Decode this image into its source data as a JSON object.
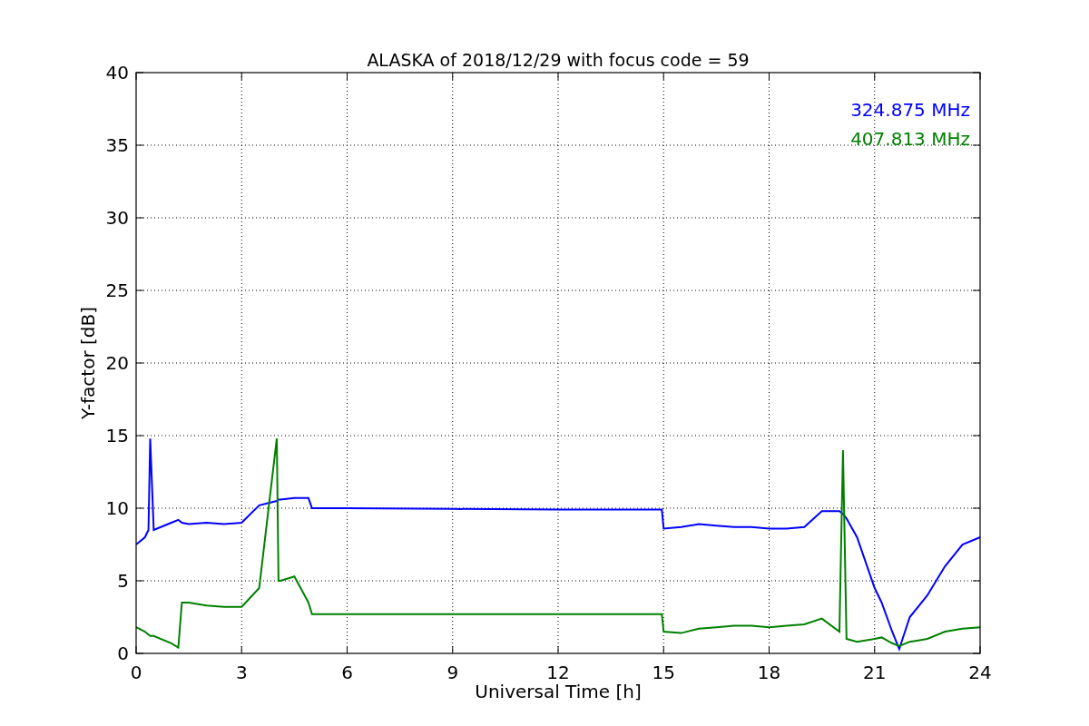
{
  "figure": {
    "chart_data": {
      "type": "line",
      "title": "ALASKA of 2018/12/29 with focus code = 59",
      "xlabel": "Universal Time [h]",
      "ylabel": "Y-factor [dB]",
      "x": [
        0,
        0.25,
        0.35,
        0.4,
        0.5,
        1,
        1.2,
        1.3,
        1.5,
        2,
        2.5,
        3,
        3.5,
        4,
        4.05,
        4.1,
        4.5,
        4.9,
        5,
        6,
        9,
        12,
        14.95,
        15,
        15.5,
        16,
        16.5,
        17,
        17.5,
        18,
        18.5,
        19,
        19.5,
        20,
        20.1,
        20.2,
        20.5,
        21,
        21.2,
        21.5,
        21.7,
        22,
        22.5,
        23,
        23.5,
        24
      ],
      "series": [
        {
          "name": "324.875 MHz",
          "color": "#0000ff",
          "values": [
            7.5,
            8.0,
            8.5,
            14.8,
            8.5,
            9.0,
            9.2,
            9.0,
            8.9,
            9.0,
            8.9,
            9.0,
            10.2,
            10.5,
            10.6,
            10.6,
            10.7,
            10.7,
            10.0,
            10.0,
            9.95,
            9.9,
            9.9,
            8.6,
            8.7,
            8.9,
            8.8,
            8.7,
            8.7,
            8.6,
            8.6,
            8.7,
            9.8,
            9.8,
            9.6,
            9.3,
            8.0,
            4.5,
            3.5,
            1.5,
            0.3,
            2.5,
            4.0,
            6.0,
            7.5,
            8.0
          ]
        },
        {
          "name": "407.813 MHz",
          "color": "#008000",
          "values": [
            1.8,
            1.5,
            1.3,
            1.2,
            1.2,
            0.7,
            0.4,
            3.5,
            3.5,
            3.3,
            3.2,
            3.2,
            4.5,
            14.8,
            5.0,
            5.0,
            5.3,
            3.5,
            2.7,
            2.7,
            2.7,
            2.7,
            2.7,
            1.5,
            1.4,
            1.7,
            1.8,
            1.9,
            1.9,
            1.8,
            1.9,
            2.0,
            2.4,
            1.5,
            14.0,
            1.0,
            0.8,
            1.0,
            1.1,
            0.7,
            0.5,
            0.8,
            1.0,
            1.5,
            1.7,
            1.8
          ]
        }
      ],
      "grid": true,
      "xlim": [
        0,
        24
      ],
      "ylim": [
        0,
        40
      ],
      "xticks": [
        0,
        3,
        6,
        9,
        12,
        15,
        18,
        21,
        24
      ],
      "yticks": [
        0,
        5,
        10,
        15,
        20,
        25,
        30,
        35,
        40
      ]
    }
  }
}
